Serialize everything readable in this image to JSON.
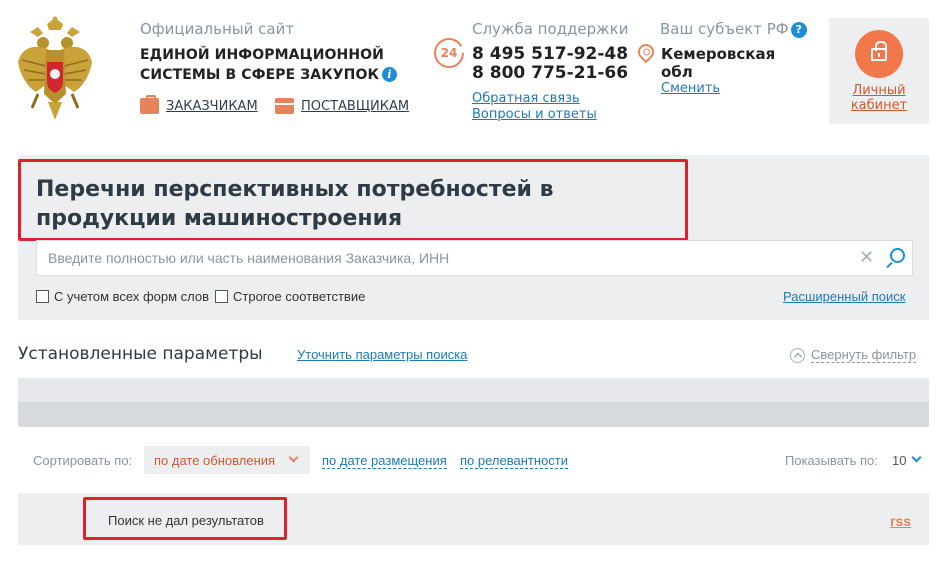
{
  "header": {
    "site_subtitle": "Официальный сайт",
    "site_title_line1": "ЕДИНОЙ ИНФОРМАЦИОННОЙ",
    "site_title_line2": "СИСТЕМЫ В СФЕРЕ ЗАКУПОК",
    "info_icon": "i",
    "customers_link": "ЗАКАЗЧИКАМ",
    "suppliers_link": "ПОСТАВЩИКАМ",
    "support": {
      "title": "Служба поддержки",
      "badge": "24",
      "phone1": "8 495 517-92-48",
      "phone2": "8 800 775-21-66",
      "feedback_link": "Обратная связь",
      "faq_link": "Вопросы и ответы"
    },
    "region": {
      "title": "Ваш субъект РФ",
      "help_icon": "?",
      "name": "Кемеровская обл",
      "change_link": "Сменить"
    },
    "cabinet_label": "Личный кабинет"
  },
  "search": {
    "page_title": "Перечни перспективных потребностей в продукции машиностроения",
    "placeholder": "Введите полностью или часть наименования Заказчика, ИНН",
    "clear_symbol": "✕",
    "option_word_forms": "С учетом всех форм слов",
    "option_strict": "Строгое соответствие",
    "advanced_link": "Расширенный поиск"
  },
  "params": {
    "title": "Установленные параметры",
    "refine_link": "Уточнить параметры поиска",
    "collapse_link": "Свернуть фильтр"
  },
  "sort": {
    "label": "Сортировать по:",
    "selected": "по дате обновления",
    "by_placement": "по дате размещения",
    "by_relevance": "по релевантности",
    "show_label": "Показывать по:",
    "show_value": "10"
  },
  "results": {
    "empty_message": "Поиск не дал результатов",
    "rss": "rss"
  },
  "colors": {
    "accent_orange": "#e8825a",
    "link_blue": "#1e7ab8",
    "highlight_red": "#e0202a",
    "panel_gray": "#eceef0"
  }
}
